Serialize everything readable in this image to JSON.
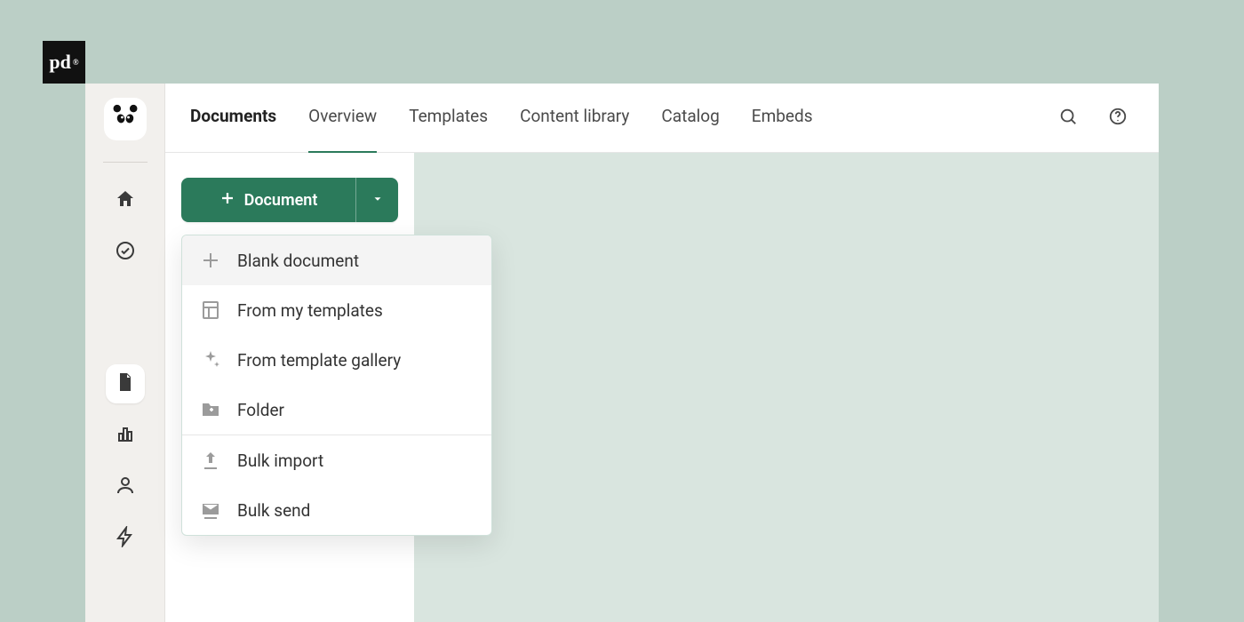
{
  "brand": {
    "pd_label": "pd"
  },
  "tabs": {
    "documents": "Documents",
    "overview": "Overview",
    "templates": "Templates",
    "content_library": "Content library",
    "catalog": "Catalog",
    "embeds": "Embeds"
  },
  "new_button": {
    "label": "Document"
  },
  "dropdown": {
    "blank": "Blank document",
    "from_my_templates": "From my templates",
    "from_gallery": "From template gallery",
    "folder": "Folder",
    "bulk_import": "Bulk import",
    "bulk_send": "Bulk send"
  }
}
